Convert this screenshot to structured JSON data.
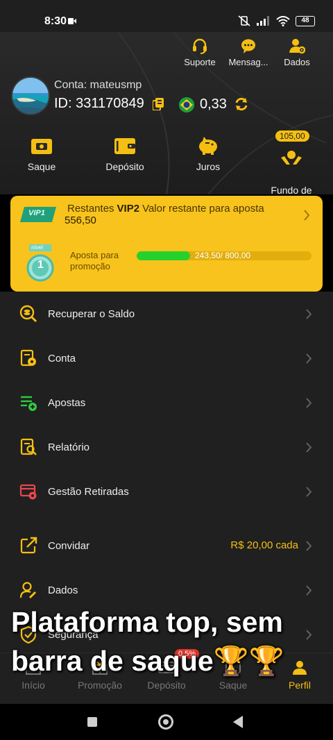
{
  "status_bar": {
    "time": "8:30",
    "battery": "48"
  },
  "header": {
    "top_icons": [
      {
        "label": "Suporte",
        "icon": "headset-icon"
      },
      {
        "label": "Mensag...",
        "icon": "chat-bubble-icon"
      },
      {
        "label": "Dados",
        "icon": "user-settings-icon"
      }
    ],
    "account_prefix": "Conta:",
    "account_name": "mateusmp",
    "id_text": "ID: 331170849",
    "balance": "0,33",
    "actions": [
      {
        "label": "Saque",
        "icon": "wallet-card-icon"
      },
      {
        "label": "Depósito",
        "icon": "deposit-wallet-icon"
      },
      {
        "label": "Juros",
        "icon": "piggy-bank-icon"
      },
      {
        "label": "Fundo de\nPrevidência",
        "icon": "hands-coin-icon",
        "badge": "105,00"
      }
    ]
  },
  "vip": {
    "badge_text": "VIP1",
    "remaining_label": "Restantes",
    "next_level": "VIP2",
    "remaining_desc": "Valor restante para aposta",
    "remaining_value": "556,50",
    "medal_label": "nível",
    "medal_number": "1",
    "promo_label": "Aposta para promoção",
    "progress_text": "243,50/ 800,00",
    "progress_fraction": 0.304
  },
  "menu": [
    {
      "label": "Recuperar o Saldo",
      "icon": "search-coins-icon"
    },
    {
      "label": "Conta",
      "icon": "account-doc-icon"
    },
    {
      "label": "Apostas",
      "icon": "bets-list-icon"
    },
    {
      "label": "Relatório",
      "icon": "report-search-icon"
    },
    {
      "label": "Gestão Retiradas",
      "icon": "withdraw-manage-icon"
    }
  ],
  "menu2": [
    {
      "label": "Convidar",
      "icon": "share-icon",
      "extra": "R$ 20,00 cada"
    },
    {
      "label": "Dados",
      "icon": "user-edit-icon"
    },
    {
      "label": "Segurança",
      "icon": "shield-icon"
    }
  ],
  "bottom_nav": [
    {
      "label": "Início",
      "icon": "home-icon"
    },
    {
      "label": "Promoção",
      "icon": "gift-icon"
    },
    {
      "label": "Depósito",
      "icon": "deposit-icon",
      "badge": "0.5%"
    },
    {
      "label": "Saque",
      "icon": "withdraw-icon"
    },
    {
      "label": "Perfil",
      "icon": "profile-icon"
    }
  ],
  "overlay_caption": "Plataforma top, sem barra de saque🏆🏆",
  "colors": {
    "accent": "#f5bf12",
    "vip_card": "#f7c31c",
    "progress": "#27d12c",
    "background": "#202020"
  }
}
